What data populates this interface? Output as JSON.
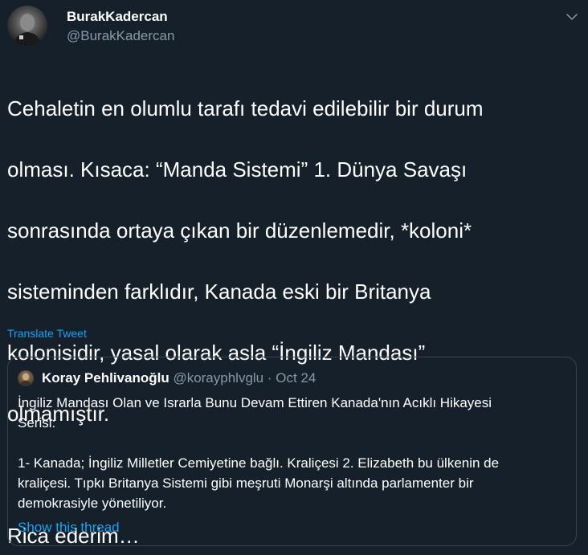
{
  "author": {
    "name": "BurakKadercan",
    "handle": "@BurakKadercan",
    "avatar_icon": "profile-photo"
  },
  "menu_icon": "chevron-down-icon",
  "tweet": {
    "lines": [
      "Cehaletin en olumlu tarafı tedavi edilebilir bir durum",
      "olması. Kısaca: “Manda Sistemi” 1. Dünya Savaşı",
      "sonrasında ortaya çıkan bir düzenlemedir, *koloni*",
      "sisteminden farklıdır, Kanada eski bir Britanya",
      "kolonisidir, yasal olarak asla “İngiliz Mandası”",
      "olmamıştır."
    ],
    "closing": "Rica ederim…"
  },
  "translate_label": "Translate Tweet",
  "quote": {
    "name": "Koray Pehlivanoğlu",
    "handle": "@korayphlvglu",
    "separator": "·",
    "date": "Oct 24",
    "lines": [
      "İngiliz Mandası Olan ve Israrla Bunu Devam Ettiren Kanada'nın Acıklı Hikayesi",
      "Serisi:",
      "1- Kanada; İngiliz Milletler Cemiyetine bağlı. Kraliçesi 2. Elizabeth bu ülkenin de",
      "kraliçesi. Tıpkı Britanya Sistemi gibi meşruti Monarşi altında parlamenter bir",
      "demokrasiyle yönetiliyor."
    ],
    "show_thread_label": "Show this thread"
  },
  "colors": {
    "background": "#15202b",
    "text": "#ffffff",
    "secondary": "#8899a6",
    "link": "#1da1f2",
    "border": "#38444d"
  }
}
